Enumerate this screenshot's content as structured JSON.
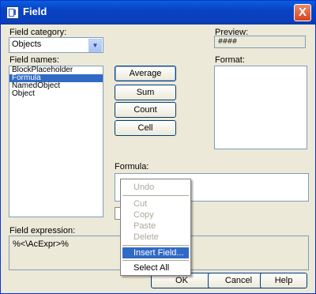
{
  "title": "Field",
  "close": "X",
  "labels": {
    "category": "Field category:",
    "names": "Field names:",
    "preview": "Preview:",
    "format": "Format:",
    "formula": "Formula:",
    "expression": "Field expression:"
  },
  "category_value": "Objects",
  "field_names": [
    "BlockPlaceholder",
    "Formula",
    "NamedObject",
    "Object"
  ],
  "selected_field": "Formula",
  "preview_value": "####",
  "buttons": {
    "average": "Average",
    "sum": "Sum",
    "count": "Count",
    "cell": "Cell"
  },
  "expression_value": "%<\\AcExpr>%",
  "footer": {
    "ok": "OK",
    "cancel": "Cancel",
    "help": "Help"
  },
  "context_menu": {
    "undo": "Undo",
    "cut": "Cut",
    "copy": "Copy",
    "paste": "Paste",
    "delete": "Delete",
    "insert_field": "Insert Field...",
    "select_all": "Select All"
  }
}
